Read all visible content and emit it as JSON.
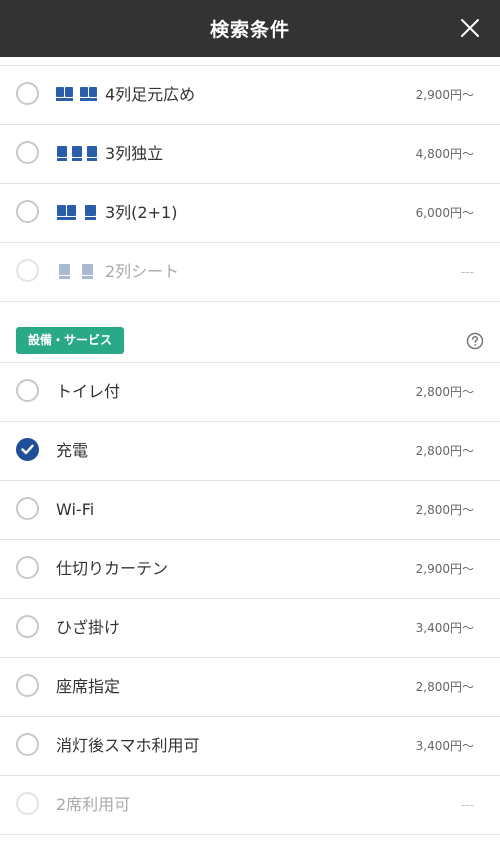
{
  "header": {
    "title": "検索条件",
    "close_icon": "close-icon"
  },
  "seat_types": [
    {
      "label": "4列足元広め",
      "price": "2,900円〜",
      "checked": false,
      "disabled": false,
      "icon": "seat-4-icon"
    },
    {
      "label": "3列独立",
      "price": "4,800円〜",
      "checked": false,
      "disabled": false,
      "icon": "seat-3-icon"
    },
    {
      "label": "3列(2+1)",
      "price": "6,000円〜",
      "checked": false,
      "disabled": false,
      "icon": "seat-2plus1-icon"
    },
    {
      "label": "2列シート",
      "price": "---",
      "checked": false,
      "disabled": true,
      "icon": "seat-2-icon"
    }
  ],
  "facilities": {
    "badge": "設備・サービス",
    "help_icon": "help-icon",
    "items": [
      {
        "label": "トイレ付",
        "price": "2,800円〜",
        "checked": false,
        "disabled": false
      },
      {
        "label": "充電",
        "price": "2,800円〜",
        "checked": true,
        "disabled": false
      },
      {
        "label": "Wi-Fi",
        "price": "2,800円〜",
        "checked": false,
        "disabled": false
      },
      {
        "label": "仕切りカーテン",
        "price": "2,900円〜",
        "checked": false,
        "disabled": false
      },
      {
        "label": "ひざ掛け",
        "price": "3,400円〜",
        "checked": false,
        "disabled": false
      },
      {
        "label": "座席指定",
        "price": "2,800円〜",
        "checked": false,
        "disabled": false
      },
      {
        "label": "消灯後スマホ利用可",
        "price": "3,400円〜",
        "checked": false,
        "disabled": false
      },
      {
        "label": "2席利用可",
        "price": "---",
        "checked": false,
        "disabled": true
      }
    ]
  },
  "colors": {
    "header_bg": "#333333",
    "accent_blue": "#1f4f96",
    "badge_green": "#2aa989",
    "divider": "#e2e2e2"
  }
}
